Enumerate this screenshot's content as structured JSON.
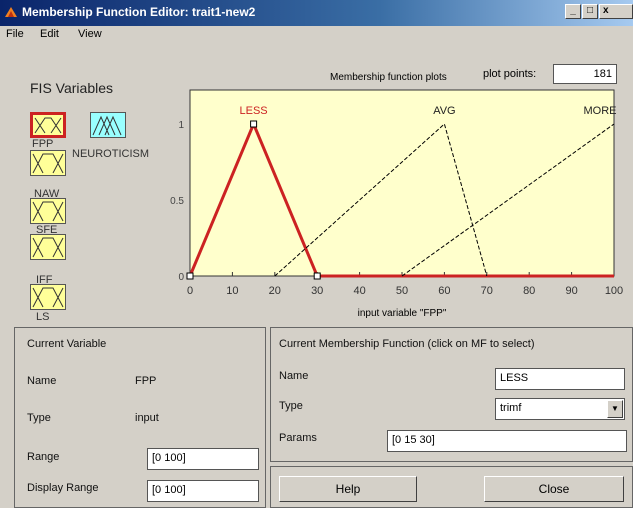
{
  "window": {
    "title": "Membership Function Editor: trait1-new2",
    "min": "_",
    "max": "□",
    "close": "x"
  },
  "menu": [
    "File",
    "Edit",
    "View"
  ],
  "fis_panel": {
    "title": "FIS Variables",
    "variables": [
      "FPP",
      "NEUROTICISM",
      "NAW",
      "SFE",
      "IFF",
      "LS"
    ]
  },
  "plot_controls": {
    "mf_plots_label": "Membership function plots",
    "plot_points_label": "plot points:",
    "plot_points_value": "181"
  },
  "chart_data": {
    "type": "line",
    "xlabel": "input variable \"FPP\"",
    "xlim": [
      0,
      100
    ],
    "ylim": [
      0,
      1
    ],
    "x_ticks": [
      "0",
      "10",
      "20",
      "30",
      "40",
      "50",
      "60",
      "70",
      "80",
      "90",
      "100"
    ],
    "y_ticks": [
      "0",
      "0.5",
      "1"
    ],
    "series": [
      {
        "name": "LESS",
        "points": [
          [
            0,
            0
          ],
          [
            15,
            1
          ],
          [
            30,
            0
          ],
          [
            100,
            0
          ]
        ],
        "selected": true
      },
      {
        "name": "AVG",
        "points": [
          [
            20,
            0
          ],
          [
            60,
            1
          ],
          [
            70,
            0
          ]
        ],
        "selected": false
      },
      {
        "name": "MORE",
        "points": [
          [
            50,
            0
          ],
          [
            100,
            1
          ]
        ],
        "selected": false
      }
    ],
    "colors": {
      "selected": "#cc2222",
      "normal": "#000000",
      "background": "#ffffcc"
    }
  },
  "current_variable": {
    "title": "Current Variable",
    "name_label": "Name",
    "name_value": "FPP",
    "type_label": "Type",
    "type_value": "input",
    "range_label": "Range",
    "range_value": "[0 100]",
    "display_range_label": "Display Range",
    "display_range_value": "[0 100]"
  },
  "current_mf": {
    "title": "Current Membership Function (click on MF to select)",
    "name_label": "Name",
    "name_value": "LESS",
    "type_label": "Type",
    "type_value": "trimf",
    "params_label": "Params",
    "params_value": "[0 15 30]"
  },
  "buttons": {
    "help": "Help",
    "close": "Close"
  }
}
